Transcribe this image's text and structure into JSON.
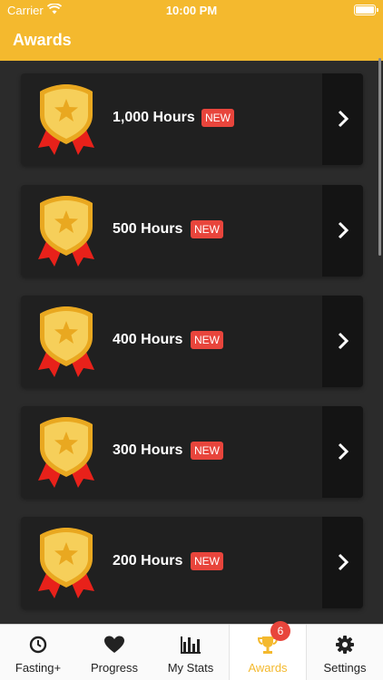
{
  "status_bar": {
    "carrier": "Carrier",
    "time": "10:00 PM"
  },
  "header": {
    "title": "Awards"
  },
  "awards": [
    {
      "label": "1,000 Hours",
      "badge": "NEW"
    },
    {
      "label": "500 Hours",
      "badge": "NEW"
    },
    {
      "label": "400 Hours",
      "badge": "NEW"
    },
    {
      "label": "300 Hours",
      "badge": "NEW"
    },
    {
      "label": "200 Hours",
      "badge": "NEW"
    }
  ],
  "tabs": [
    {
      "label": "Fasting+",
      "icon": "clock-icon"
    },
    {
      "label": "Progress",
      "icon": "heart-icon"
    },
    {
      "label": "My Stats",
      "icon": "bar-chart-icon"
    },
    {
      "label": "Awards",
      "icon": "trophy-icon",
      "badge": "6",
      "active": true
    },
    {
      "label": "Settings",
      "icon": "gear-icon"
    }
  ],
  "colors": {
    "accent": "#f4b92e",
    "badge": "#e8453c",
    "card": "#202020",
    "background": "#2b2b2b"
  }
}
